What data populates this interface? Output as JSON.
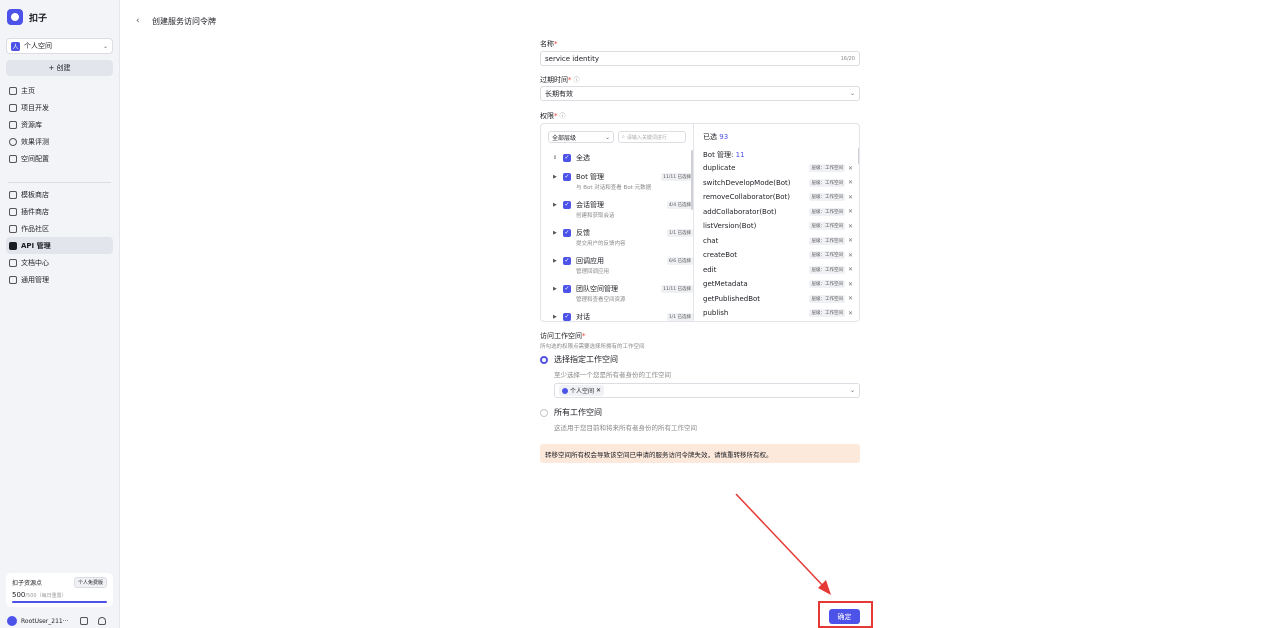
{
  "app": {
    "name": "扣子"
  },
  "sidebar": {
    "space": "个人空间",
    "create": "+ 创建",
    "nav_top": [
      {
        "label": "主页",
        "icon": "home-icon"
      },
      {
        "label": "项目开发",
        "icon": "project-icon"
      },
      {
        "label": "资源库",
        "icon": "library-icon"
      },
      {
        "label": "效果评测",
        "icon": "evaluation-icon"
      },
      {
        "label": "空间配置",
        "icon": "space-config-icon"
      }
    ],
    "nav_bottom": [
      {
        "label": "模板商店",
        "icon": "template-store-icon"
      },
      {
        "label": "插件商店",
        "icon": "plugin-store-icon"
      },
      {
        "label": "作品社区",
        "icon": "community-icon"
      },
      {
        "label": "API 管理",
        "icon": "api-icon",
        "active": true
      },
      {
        "label": "文档中心",
        "icon": "docs-icon"
      },
      {
        "label": "通用管理",
        "icon": "settings-icon"
      }
    ],
    "credits": {
      "title": "扣子资源点",
      "plan": "个人免费版",
      "value": "500",
      "total": "/500（每日重置）",
      "ratio": 1.0
    },
    "user": "RootUser_211···"
  },
  "header": {
    "back": "‹",
    "title": "创建服务访问令牌"
  },
  "form": {
    "name_label": "名称",
    "name_value": "service identity",
    "name_counter": "16/20",
    "expire_label": "过期时间",
    "expire_value": "长期有效",
    "perm_label": "权限",
    "level_select": "全部层级",
    "search_placeholder": "请输入关键词进行",
    "select_all": "全选",
    "groups": [
      {
        "name": "Bot 管理",
        "count": "11/11 已选择",
        "desc": "与 Bot 对话和查看 Bot 元数据"
      },
      {
        "name": "会话管理",
        "count": "4/4 已选择",
        "desc": "创建和获取会话"
      },
      {
        "name": "反馈",
        "count": "1/1 已选择",
        "desc": "提交用户的反馈内容"
      },
      {
        "name": "回调应用",
        "count": "6/6 已选择",
        "desc": "管理回调应用"
      },
      {
        "name": "团队空间管理",
        "count": "11/11 已选择",
        "desc": "管理和查看空间资源"
      },
      {
        "name": "对话",
        "count": "1/1 已选择",
        "desc": ""
      }
    ],
    "selected_head": "已选",
    "selected_count": "93",
    "selected_group": "Bot 管理:",
    "selected_group_count": "11",
    "selected_tag": "层级：工作空间",
    "selected_items": [
      "duplicate",
      "switchDevelopMode(Bot)",
      "removeCollaborator(Bot)",
      "addCollaborator(Bot)",
      "listVersion(Bot)",
      "chat",
      "createBot",
      "edit",
      "getMetadata",
      "getPublishedBot",
      "publish"
    ],
    "ws_label": "访问工作空间",
    "ws_hint": "所勾选的权限点需要选择所拥有的工作空间",
    "option1": "选择指定工作空间",
    "option1_hint": "至少选择一个您是所有者身份的工作空间",
    "ws_chip": "个人空间",
    "option2": "所有工作空间",
    "option2_hint": "这适用于您目前和将来所有者身份的所有工作空间",
    "warning": "转移空间所有权会导致该空间已申请的服务访问令牌失效，请慎重转移所有权。",
    "confirm": "确定"
  },
  "colors": {
    "accent": "#4d53e8",
    "annotation": "#e53935",
    "warning_bg": "#fde9db"
  }
}
